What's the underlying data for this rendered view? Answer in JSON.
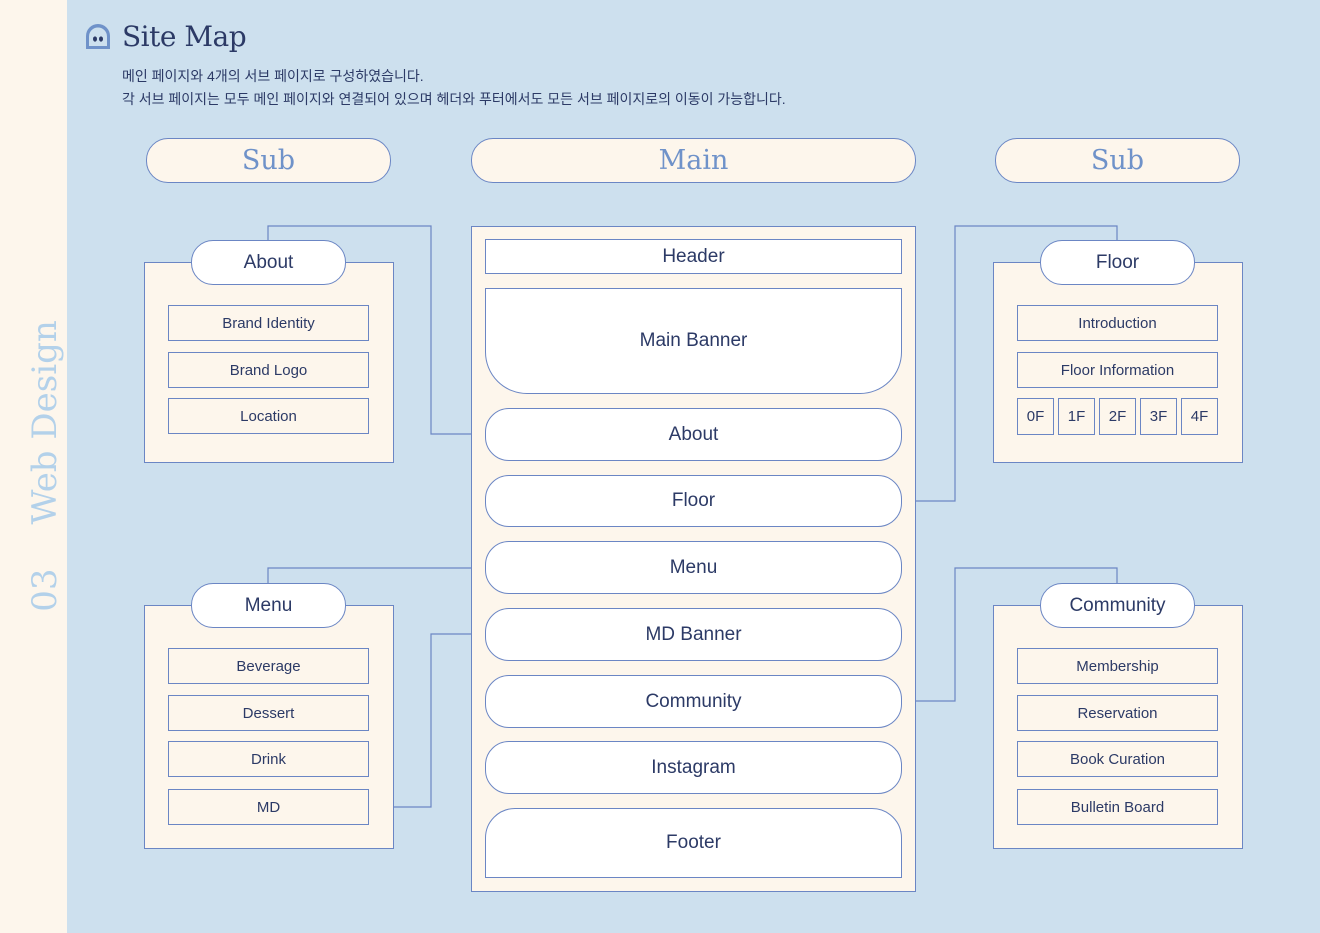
{
  "side_label": {
    "number": "03",
    "text": "Web Design"
  },
  "header": {
    "title": "Site Map",
    "desc1": "메인 페이지와 4개의 서브 페이지로 구성하였습니다.",
    "desc2": "각 서브 페이지는 모두 메인 페이지와 연결되어 있으며 헤더와 푸터에서도 모든 서브 페이지로의 이동이 가능합니다."
  },
  "columns": {
    "left": "Sub",
    "center": "Main",
    "right": "Sub"
  },
  "about": {
    "title": "About",
    "items": [
      "Brand Identity",
      "Brand Logo",
      "Location"
    ]
  },
  "menu": {
    "title": "Menu",
    "items": [
      "Beverage",
      "Dessert",
      "Drink",
      "MD"
    ]
  },
  "floor": {
    "title": "Floor",
    "items": [
      "Introduction",
      "Floor Information"
    ],
    "floors": [
      "0F",
      "1F",
      "2F",
      "3F",
      "4F"
    ]
  },
  "community": {
    "title": "Community",
    "items": [
      "Membership",
      "Reservation",
      "Book Curation",
      "Bulletin Board"
    ]
  },
  "main": {
    "header": "Header",
    "banner": "Main Banner",
    "sections": [
      "About",
      "Floor",
      "Menu",
      "MD Banner",
      "Community",
      "Instagram"
    ],
    "footer": "Footer"
  },
  "colors": {
    "background": "#cde0ee",
    "panel": "#fdf6ec",
    "line": "#6b86c4",
    "accent": "#6f92c9",
    "text": "#2c3a66"
  }
}
